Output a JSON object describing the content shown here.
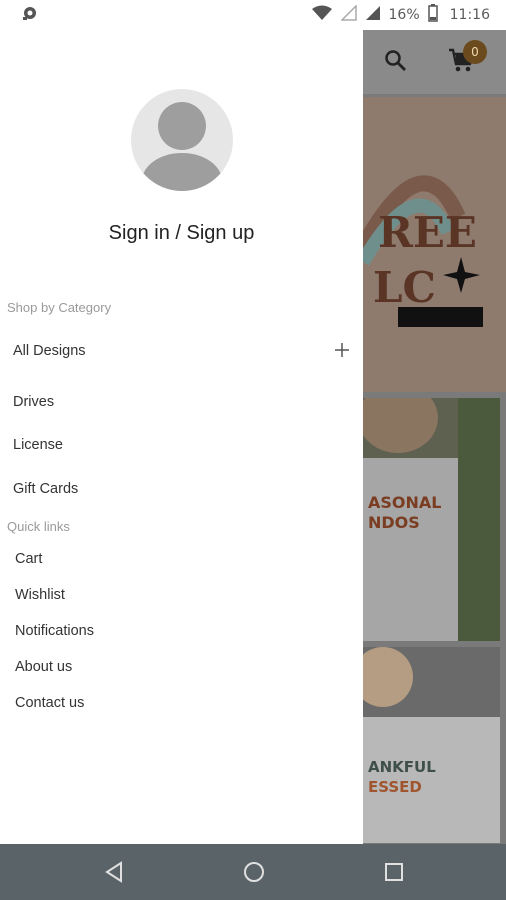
{
  "status_bar": {
    "battery": "16%",
    "time": "11:16"
  },
  "drawer": {
    "sign_in_label": "Sign in / Sign up",
    "shop_by_category_label": "Shop by Category",
    "categories": [
      "All Designs",
      "Drives",
      "License",
      "Gift Cards"
    ],
    "quick_links_label": "Quick links",
    "quick_links": [
      "Cart",
      "Wishlist",
      "Notifications",
      "About us",
      "Contact us"
    ]
  },
  "background": {
    "cart_count": "0"
  },
  "colors": {
    "overlay": "#7a7a7a",
    "cart_badge": "#6b4a1e",
    "nav_bar": "#5a6367"
  }
}
